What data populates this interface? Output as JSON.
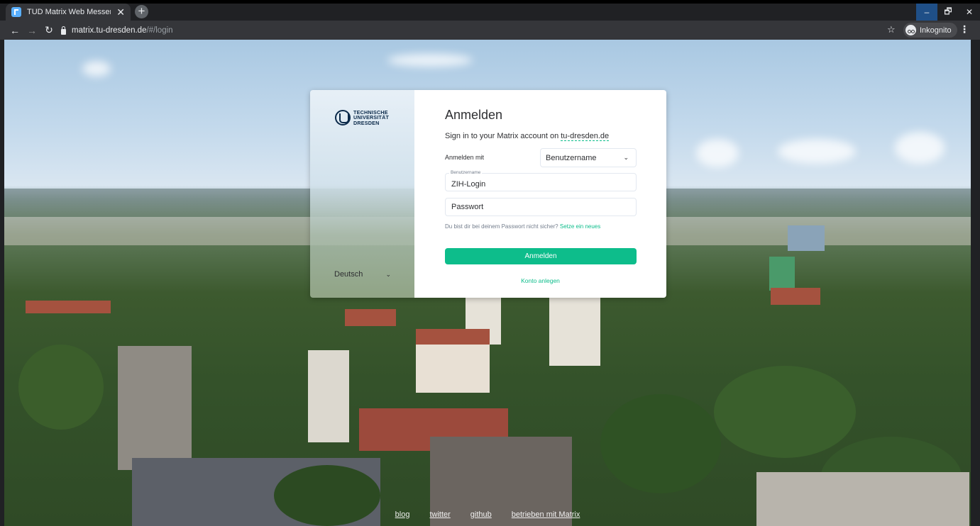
{
  "browser": {
    "tab_title": "TUD Matrix Web Messenger",
    "tab_close": "✕",
    "new_tab": "+",
    "url_host": "matrix.tu-dresden.de",
    "url_path": "/#/login",
    "profile_label": "Inkognito",
    "window_controls": [
      "–",
      "🗗",
      "✕"
    ]
  },
  "brand": {
    "logo_lines": [
      "TECHNISCHE",
      "UNIVERSITÄT",
      "DRESDEN"
    ],
    "language": "Deutsch"
  },
  "login": {
    "title": "Anmelden",
    "subtitle_prefix": "Sign in to your Matrix account on ",
    "server": "tu-dresden.de",
    "login_with_label": "Anmelden mit",
    "login_type": "Benutzername",
    "username_floating_label": "Benutzername",
    "username_value": "ZIH-Login",
    "password_placeholder": "Passwort",
    "password_hint": "Du bist dir bei deinem Passwort nicht sicher?",
    "password_reset_link": "Setze ein neues",
    "submit_label": "Anmelden",
    "create_account_label": "Konto anlegen"
  },
  "footer": {
    "links": [
      "blog",
      "twitter",
      "github",
      "betrieben mit Matrix"
    ]
  },
  "colors": {
    "accent": "#0dbd8b",
    "text": "#2e2f32",
    "muted": "#737d8c"
  }
}
